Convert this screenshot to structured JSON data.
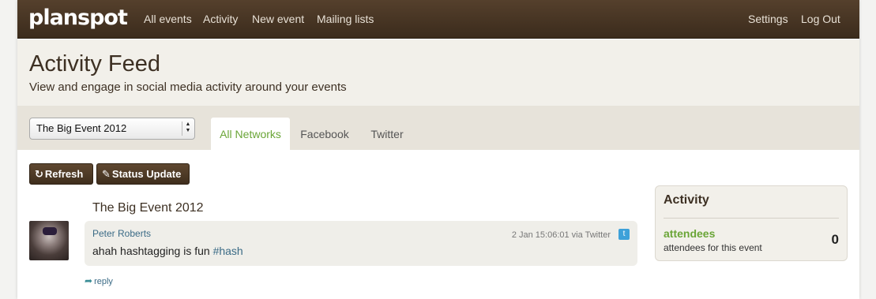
{
  "nav": {
    "logo": "planspot",
    "links": [
      "All events",
      "Activity",
      "New event",
      "Mailing lists"
    ],
    "right_links": [
      "Settings",
      "Log Out"
    ]
  },
  "header": {
    "title": "Activity Feed",
    "subtitle": "View and engage in social media activity around your events"
  },
  "filters": {
    "event_select": "The Big Event 2012",
    "tabs": [
      "All Networks",
      "Facebook",
      "Twitter"
    ],
    "active_tab": "All Networks"
  },
  "toolbar": {
    "refresh_label": "Refresh",
    "status_update_label": "Status Update"
  },
  "feed": {
    "event_name": "The Big Event 2012",
    "post": {
      "author": "Peter Roberts",
      "text": "ahah hashtagging is fun ",
      "hashtag": "#hash",
      "meta": "2 Jan 15:06:01 via Twitter",
      "reply_label": "reply"
    }
  },
  "sidebar": {
    "title": "Activity",
    "stat_label": "attendees",
    "stat_description": "attendees for this event",
    "stat_value": "0"
  },
  "colors": {
    "topbar": "#3b2b1c",
    "accent_green": "#6aa537",
    "link_blue": "#3b6b86",
    "twitter_blue": "#3ea1d9"
  }
}
